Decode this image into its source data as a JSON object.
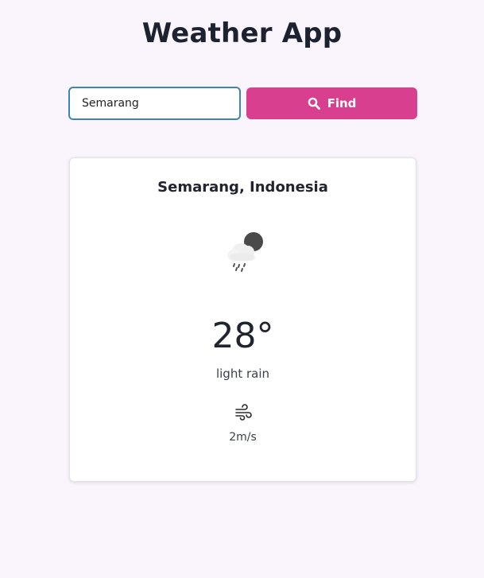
{
  "app": {
    "title": "Weather App"
  },
  "search": {
    "value": "Semarang",
    "button_label": "Find",
    "button_icon": "search-icon"
  },
  "weather": {
    "location": "Semarang, Indonesia",
    "icon": "cloud-moon-rain-icon",
    "temperature": "28°",
    "description": "light rain",
    "wind_icon": "wind-icon",
    "wind_speed": "2m/s"
  },
  "colors": {
    "background": "#faf4fd",
    "accent": "#d93f8f",
    "input_border": "#3c86b4"
  }
}
